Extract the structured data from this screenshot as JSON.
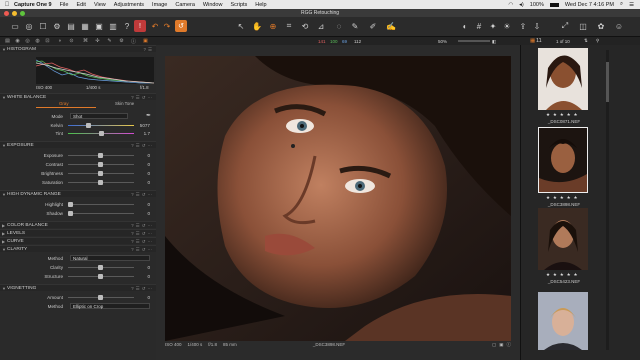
{
  "menubar": {
    "app": "Capture One 9",
    "items": [
      "File",
      "Edit",
      "View",
      "Adjustments",
      "Image",
      "Camera",
      "Window",
      "Scripts",
      "Help"
    ],
    "battery": "100%",
    "clock": "Wed Dec 7  4:16 PM"
  },
  "window": {
    "title": "RGG Retouching"
  },
  "toolbar": {
    "r": "141",
    "g": "100",
    "b": "69",
    "w": "112",
    "zoom_percent": "50%",
    "counter": "1 of 10"
  },
  "browser_header": {
    "count": "11"
  },
  "histogram": {
    "title": "HISTOGRAM",
    "iso": "ISO 400",
    "shutter": "1/400 s",
    "aperture": "f/1.8"
  },
  "white_balance": {
    "title": "WHITE BALANCE",
    "tabs": [
      "Gray",
      "Skin Tone"
    ],
    "mode_label": "Mode",
    "mode_value": "Shot",
    "kelvin_label": "Kelvin",
    "kelvin_value": "5077",
    "tint_label": "Tint",
    "tint_value": "1.7",
    "kelvin_fill": 0.3,
    "tint_fill": 0.5
  },
  "exposure": {
    "title": "EXPOSURE",
    "rows": [
      {
        "label": "Exposure",
        "value": "0"
      },
      {
        "label": "Contrast",
        "value": "0"
      },
      {
        "label": "Brightness",
        "value": "0"
      },
      {
        "label": "Saturation",
        "value": "0"
      }
    ]
  },
  "hdr": {
    "title": "HIGH DYNAMIC RANGE",
    "rows": [
      {
        "label": "Highlight",
        "value": "0"
      },
      {
        "label": "Shadow",
        "value": "0"
      }
    ]
  },
  "collapsed_sections": [
    "COLOR BALANCE",
    "LEVELS",
    "CURVE"
  ],
  "clarity": {
    "title": "CLARITY",
    "method_label": "Method",
    "method_value": "Natural",
    "rows": [
      {
        "label": "Clarity",
        "value": "0"
      },
      {
        "label": "Structure",
        "value": "0"
      }
    ]
  },
  "vignetting": {
    "title": "VIGNETTING",
    "amount_label": "Amount",
    "amount_value": "0",
    "method_label": "Method",
    "method_value": "Elliptic on Crop"
  },
  "viewer": {
    "iso": "ISO 400",
    "shutter": "1/400 s",
    "aperture": "f/1.8",
    "focal": "85 mm",
    "filename": "_DSC3898.NEF"
  },
  "browser": {
    "thumbs": [
      {
        "name": "_DSC0871.NEF",
        "stars": "★ ★ ★ ★ ★"
      },
      {
        "name": "_DSC3898.NEF",
        "stars": "★ ★ ★ ★ ★"
      },
      {
        "name": "_DSC5423.NEF",
        "stars": "★ ★ ★ ★ ★"
      },
      {
        "name": "",
        "stars": ""
      }
    ]
  },
  "colors": {
    "accent": "#e07a2a",
    "green": "#5bbf5b",
    "red_badge": "#c03a3a"
  }
}
